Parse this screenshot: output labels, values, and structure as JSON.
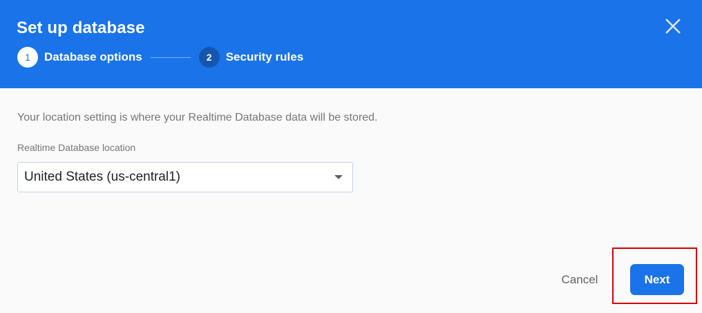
{
  "dialog": {
    "title": "Set up database",
    "close_icon": "close-icon"
  },
  "stepper": {
    "steps": [
      {
        "number": "1",
        "label": "Database options",
        "state": "active"
      },
      {
        "number": "2",
        "label": "Security rules",
        "state": "inactive"
      }
    ]
  },
  "content": {
    "description": "Your location setting is where your Realtime Database data will be stored.",
    "location_label": "Realtime Database location",
    "location_value": "United States (us-central1)",
    "dropdown_icon": "dropdown-arrow-icon"
  },
  "actions": {
    "cancel_label": "Cancel",
    "next_label": "Next"
  },
  "colors": {
    "header": "#1a73e8",
    "primary_button": "#1a73e8",
    "highlight": "#d00000"
  }
}
